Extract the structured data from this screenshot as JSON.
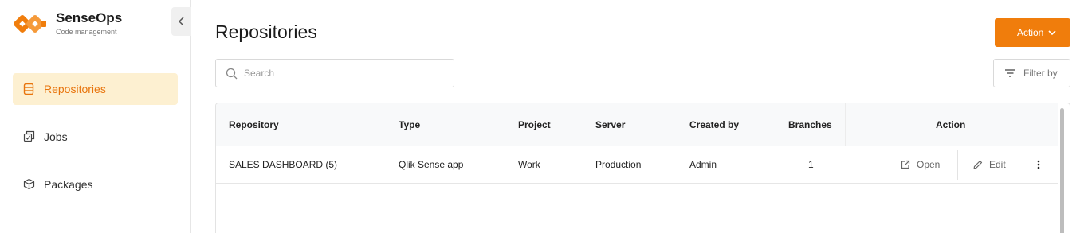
{
  "brand": {
    "name": "SenseOps",
    "subtitle": "Code management"
  },
  "sidebar": {
    "items": [
      {
        "label": "Repositories",
        "icon": "database-icon",
        "active": true
      },
      {
        "label": "Jobs",
        "icon": "jobs-icon",
        "active": false
      },
      {
        "label": "Packages",
        "icon": "package-icon",
        "active": false
      }
    ]
  },
  "header": {
    "title": "Repositories",
    "action_label": "Action"
  },
  "search": {
    "placeholder": "Search",
    "value": ""
  },
  "filter": {
    "label": "Filter by"
  },
  "table": {
    "columns": [
      "Repository",
      "Type",
      "Project",
      "Server",
      "Created by",
      "Branches",
      "Action"
    ],
    "rows": [
      {
        "repository": "SALES DASHBOARD (5)",
        "type": "Qlik Sense app",
        "project": "Work",
        "server": "Production",
        "created_by": "Admin",
        "branches": "1",
        "open_label": "Open",
        "edit_label": "Edit"
      }
    ]
  },
  "colors": {
    "accent": "#f07d0c",
    "active_bg": "#fdf0d1",
    "active_text": "#e8740c"
  }
}
